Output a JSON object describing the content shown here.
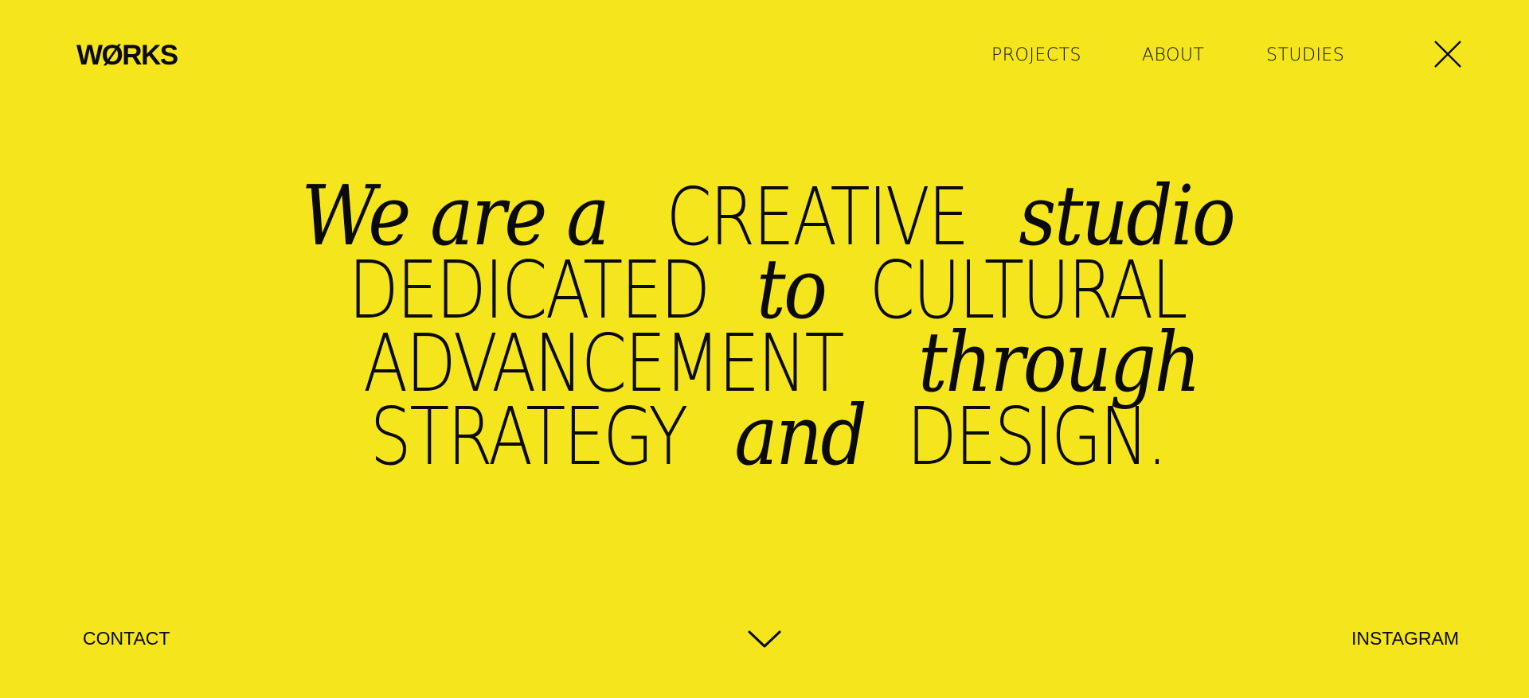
{
  "brand": {
    "logo_text": "WØRKS"
  },
  "nav": {
    "items": [
      {
        "label": "PROJECTS"
      },
      {
        "label": "ABOUT"
      },
      {
        "label": "STUDIES"
      }
    ],
    "close_icon": "close-icon"
  },
  "hero": {
    "lines": [
      [
        {
          "text": "We are a",
          "style": "serif-italic"
        },
        {
          "text": "CREATIVE",
          "style": "sans"
        },
        {
          "text": "studio",
          "style": "serif-italic"
        }
      ],
      [
        {
          "text": "DEDICATED",
          "style": "sans"
        },
        {
          "text": "to",
          "style": "serif-italic"
        },
        {
          "text": "CULTURAL",
          "style": "sans"
        }
      ],
      [
        {
          "text": "ADVANCEMENT",
          "style": "sans"
        },
        {
          "text": "through",
          "style": "serif-italic"
        }
      ],
      [
        {
          "text": "STRATEGY",
          "style": "sans"
        },
        {
          "text": "and",
          "style": "serif-italic"
        },
        {
          "text": "DESIGN.",
          "style": "sans"
        }
      ]
    ]
  },
  "footer": {
    "contact_label": "CONTACT",
    "instagram_label": "INSTAGRAM",
    "scroll_icon": "chevron-down-icon"
  },
  "colors": {
    "background": "#f5e51c",
    "foreground": "#0a0a0a"
  }
}
